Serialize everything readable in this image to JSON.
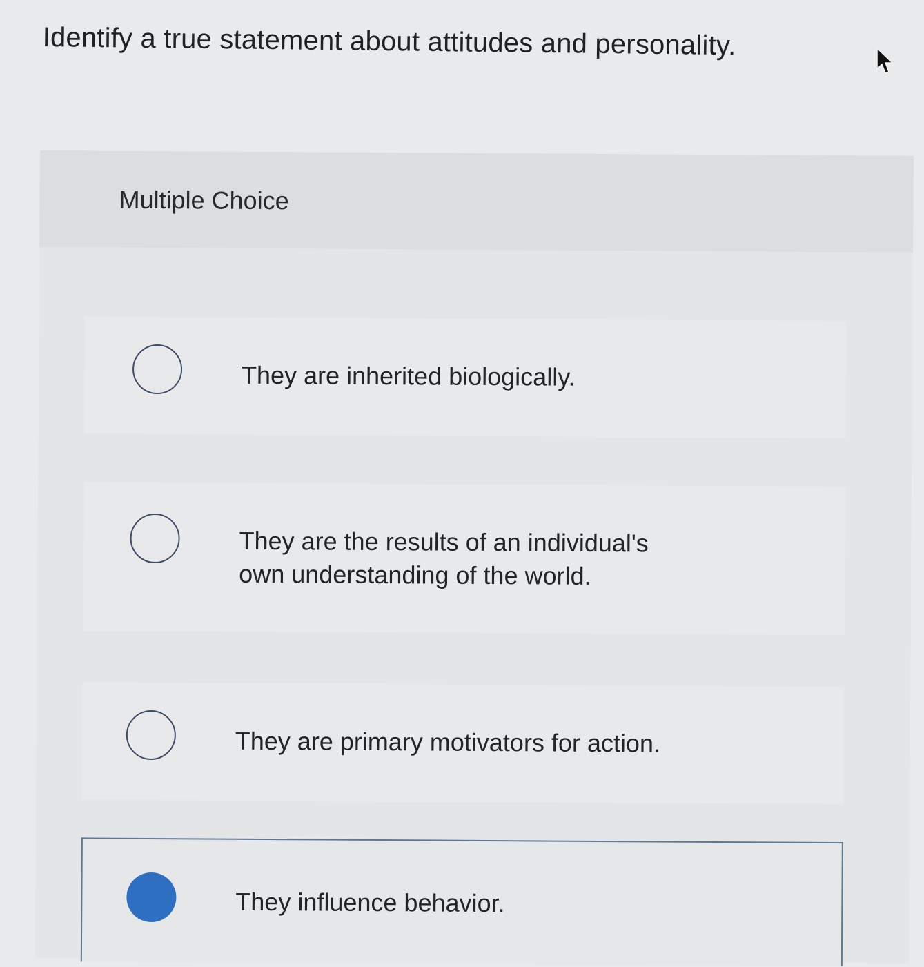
{
  "question": {
    "text": "Identify a true statement about attitudes and personality."
  },
  "panel": {
    "title": "Multiple Choice"
  },
  "choices": [
    {
      "text": "They are inherited biologically.",
      "selected": false
    },
    {
      "text": "They are the results of an individual's\nown understanding of the world.",
      "selected": false
    },
    {
      "text": "They are primary motivators for action.",
      "selected": false
    },
    {
      "text": "They influence behavior.",
      "selected": true
    }
  ],
  "colors": {
    "selected_radio": "#2f6fc2",
    "radio_outline": "#3d4d66",
    "selected_border": "#5d7893"
  },
  "icons": {
    "pointer": "mouse-pointer-icon"
  }
}
